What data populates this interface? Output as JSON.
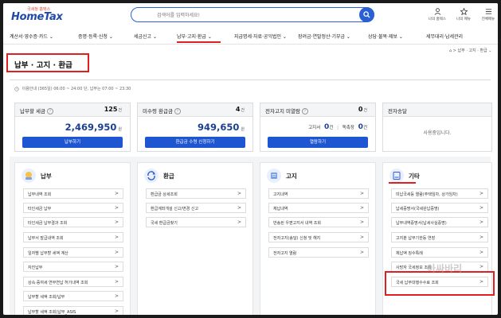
{
  "header": {
    "logo_small": "국세청 홈택스",
    "logo_text": "HomeTax",
    "search_placeholder": "검색어를 입력하세요!",
    "utils": [
      {
        "label": "나의 홈택스",
        "icon": "user-icon"
      },
      {
        "label": "나의 메뉴",
        "icon": "star-icon"
      },
      {
        "label": "전체메뉴",
        "icon": "menu-icon"
      }
    ]
  },
  "nav": {
    "items": [
      "계산서·영수증·카드 ⌄",
      "증명·등록·신청 ⌄",
      "세금신고 ⌄",
      "납부·고지·환급 ⌄",
      "지급명세·자료·공익법인 ⌄",
      "장려금·연말정산·기부금 ⌄",
      "상담·불복·제보 ⌄",
      "세무대리·납세관리"
    ],
    "active_index": 3
  },
  "breadcrumb": "⌂ > 납부 · 고지 · 환급 ⌄",
  "page_title": "납부 · 고지 · 환급",
  "notice": "이용안내 (365일) 06:00 ~ 24:00 단, 납부는 07:00 ~ 23:30",
  "cards": [
    {
      "label": "납부할 세금",
      "count": "125",
      "unit": "건",
      "amount": "2,469,950",
      "amount_unit": "원",
      "button": "납부하기"
    },
    {
      "label": "미수령 환급금",
      "count": "4",
      "unit": "건",
      "amount": "949,650",
      "amount_unit": "원",
      "button": "환급금 수령 신청하기"
    },
    {
      "label": "전자고지 미열람",
      "count": "0",
      "unit": "건",
      "sub1_label": "고지서",
      "sub1_count": "0",
      "sub2_label": "독촉장",
      "sub2_count": "0",
      "sub_unit": "건",
      "button": "열람하기"
    },
    {
      "label": "전자송달",
      "status": "사용중입니다."
    }
  ],
  "panels": [
    {
      "title": "납부",
      "icon": "payment-icon",
      "items": [
        "납부내역 조회",
        "타인세금 납부",
        "타인세금 납부결과 조회",
        "납부서 발급내역 조회",
        "일자별 납부할 세액 계산",
        "자진납부",
        "상속·증여세 연부연납 허가내역 조회",
        "납부할 세액 조회/납부",
        "납부할 세액 조회(납부_ASIS"
      ]
    },
    {
      "title": "환급",
      "icon": "refund-icon",
      "items": [
        "환급금 상세조회",
        "환급계좌개설 신고/변경 신고",
        "국세 환급금찾기"
      ]
    },
    {
      "title": "고지",
      "icon": "notice-icon",
      "items": [
        "고지내역",
        "체납내역",
        "반송된 우편고지서 내역 조회",
        "전자고지(송달) 신청 및 해지",
        "전자고지 열람"
      ]
    },
    {
      "title": "기타",
      "icon": "etc-icon",
      "items": [
        "미납국세등 열람(주택임차, 상가임차)",
        "납세증명서(국세완납증명)",
        "납부내역증명서(납세사실증명)",
        "고지분 납부기한등 연장",
        "체납액 징수특례",
        "사망자 국세정보 조회",
        "국세 납부대행수수료 조회"
      ]
    }
  ],
  "watermark": "아싸바리"
}
